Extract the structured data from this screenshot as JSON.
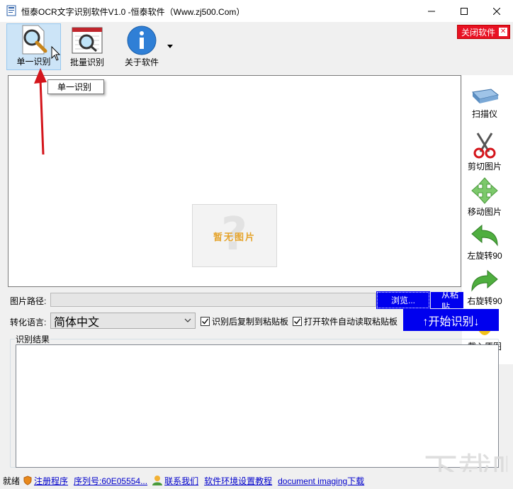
{
  "window": {
    "title": "恒泰OCR文字识别软件V1.0 -恒泰软件（Www.zj500.Com）"
  },
  "toolbar": {
    "single_label": "单一识别",
    "batch_label": "批量识别",
    "about_label": "关于软件",
    "close_software": "关闭软件"
  },
  "tooltip": "单一识别",
  "image_area": {
    "placeholder": "暂无图片"
  },
  "side": {
    "scanner": "扫描仪",
    "crop": "剪切图片",
    "move": "移动图片",
    "rotate_left": "左旋转90",
    "rotate_right": "右旋转90",
    "load_original": "载入原图"
  },
  "path": {
    "label": "图片路径:",
    "value": "",
    "browse": "浏览...",
    "paste": "从粘贴"
  },
  "lang": {
    "label": "转化语言:",
    "selected": "简体中文",
    "copy_after": "识别后复制到粘贴板",
    "copy_after_checked": true,
    "auto_read": "打开软件自动读取粘贴板",
    "auto_read_checked": true,
    "start": "↑开始识别↓"
  },
  "result": {
    "legend": "识别结果",
    "text": ""
  },
  "status": {
    "ready": "就绪",
    "register": "注册程序",
    "serial": "序列号:60E05554...",
    "contact": "联系我们",
    "tutorial": "软件环境设置教程",
    "download": "document imaging下载"
  },
  "watermark": "下载吧",
  "colors": {
    "accent_blue": "#0000ee",
    "close_red": "#e81123",
    "arrow_red": "#d4151b"
  }
}
